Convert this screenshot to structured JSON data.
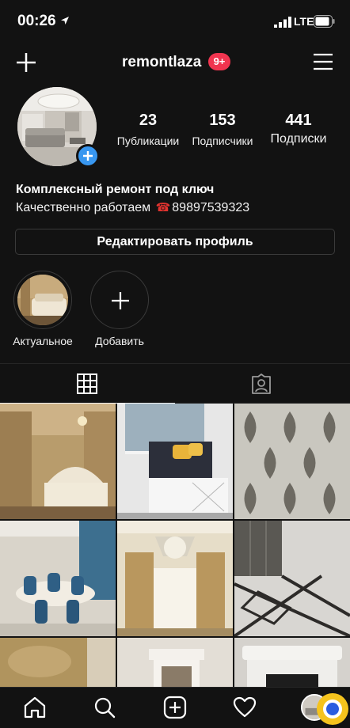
{
  "status_bar": {
    "time": "00:26",
    "network": "LTE"
  },
  "header": {
    "username": "remontlaza",
    "notification_badge": "9+",
    "badge_color": "#f0344f",
    "left_icon": "plus-icon",
    "right_icon": "hamburger-menu-icon"
  },
  "profile": {
    "stats": [
      {
        "value": "23",
        "label": "Публикации"
      },
      {
        "value": "153",
        "label": "Подписчики"
      },
      {
        "value": "441",
        "label": "Подписки"
      }
    ],
    "bio_name": "Комплексный ремонт под ключ",
    "bio_text": "Качественно работаем",
    "bio_phone_icon": "telephone-icon",
    "bio_phone": "89897539323",
    "edit_button": "Редактировать профиль"
  },
  "highlights": [
    {
      "label": "Актуальное"
    },
    {
      "label": "Добавить"
    }
  ],
  "tabs": [
    {
      "icon": "grid-icon",
      "active": true
    },
    {
      "icon": "tagged-person-icon",
      "active": false
    }
  ],
  "posts": [
    {
      "subject": "bedroom with gold curtains"
    },
    {
      "subject": "balcony with yellow pillows"
    },
    {
      "subject": "damask wallpaper"
    },
    {
      "subject": "dining room with blue chairs"
    },
    {
      "subject": "hall with chandelier and curtains"
    },
    {
      "subject": "marble floor with mirror wall"
    },
    {
      "subject": "gold textured wall"
    },
    {
      "subject": "doorway with moulding"
    },
    {
      "subject": "white carved fireplace"
    }
  ],
  "bottom_nav": [
    {
      "icon": "home-icon"
    },
    {
      "icon": "search-icon"
    },
    {
      "icon": "new-post-icon"
    },
    {
      "icon": "heart-icon"
    },
    {
      "icon": "profile-avatar-icon"
    }
  ],
  "accent_color": "#3897f0"
}
